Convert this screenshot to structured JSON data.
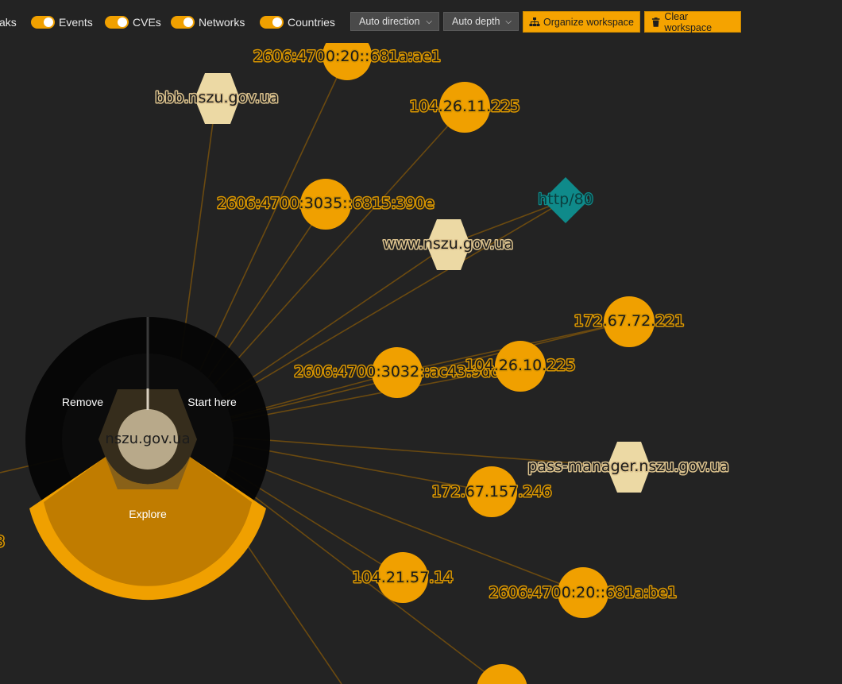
{
  "toolbar": {
    "toggles": [
      {
        "label": "aks",
        "on": true
      },
      {
        "label": "Events",
        "on": true
      },
      {
        "label": "CVEs",
        "on": true
      },
      {
        "label": "Networks",
        "on": true
      },
      {
        "label": "Countries",
        "on": true
      }
    ],
    "direction_select": "Auto direction",
    "depth_select": "Auto depth",
    "organize_label": "Organize workspace",
    "clear_label": "Clear workspace",
    "accent": "#f5a300"
  },
  "graph": {
    "center_label": "nszu.gov.ua",
    "context_menu": {
      "remove": "Remove",
      "start_here": "Start here",
      "explore": "Explore"
    },
    "nodes": {
      "ip_1": "2606:4700:20::681a:ae1",
      "ip_2": "104.26.11.225",
      "ip_3": "2606:4700:3035::6815:390e",
      "ip_4": "172.67.72.221",
      "ip_5": "2606:4700:3032::ac43:9dd",
      "ip_6": "104.26.10.225",
      "ip_7": "172.67.157.246",
      "ip_8": "104.21.57.14",
      "ip_9": "2606:4700:20::681a:be1",
      "dom_1": "bbb.nszu.gov.ua",
      "dom_2": "www.nszu.gov.ua",
      "dom_3": "pass-manager.nszu.gov.ua",
      "svc_1": "http/80",
      "partial_left": "3"
    },
    "colors": {
      "ip_node": "#f0a000",
      "domain_node": "#ecd9a4",
      "service_node": "#0f8a8a",
      "edge": "#6b4a10",
      "background": "#232323"
    }
  }
}
